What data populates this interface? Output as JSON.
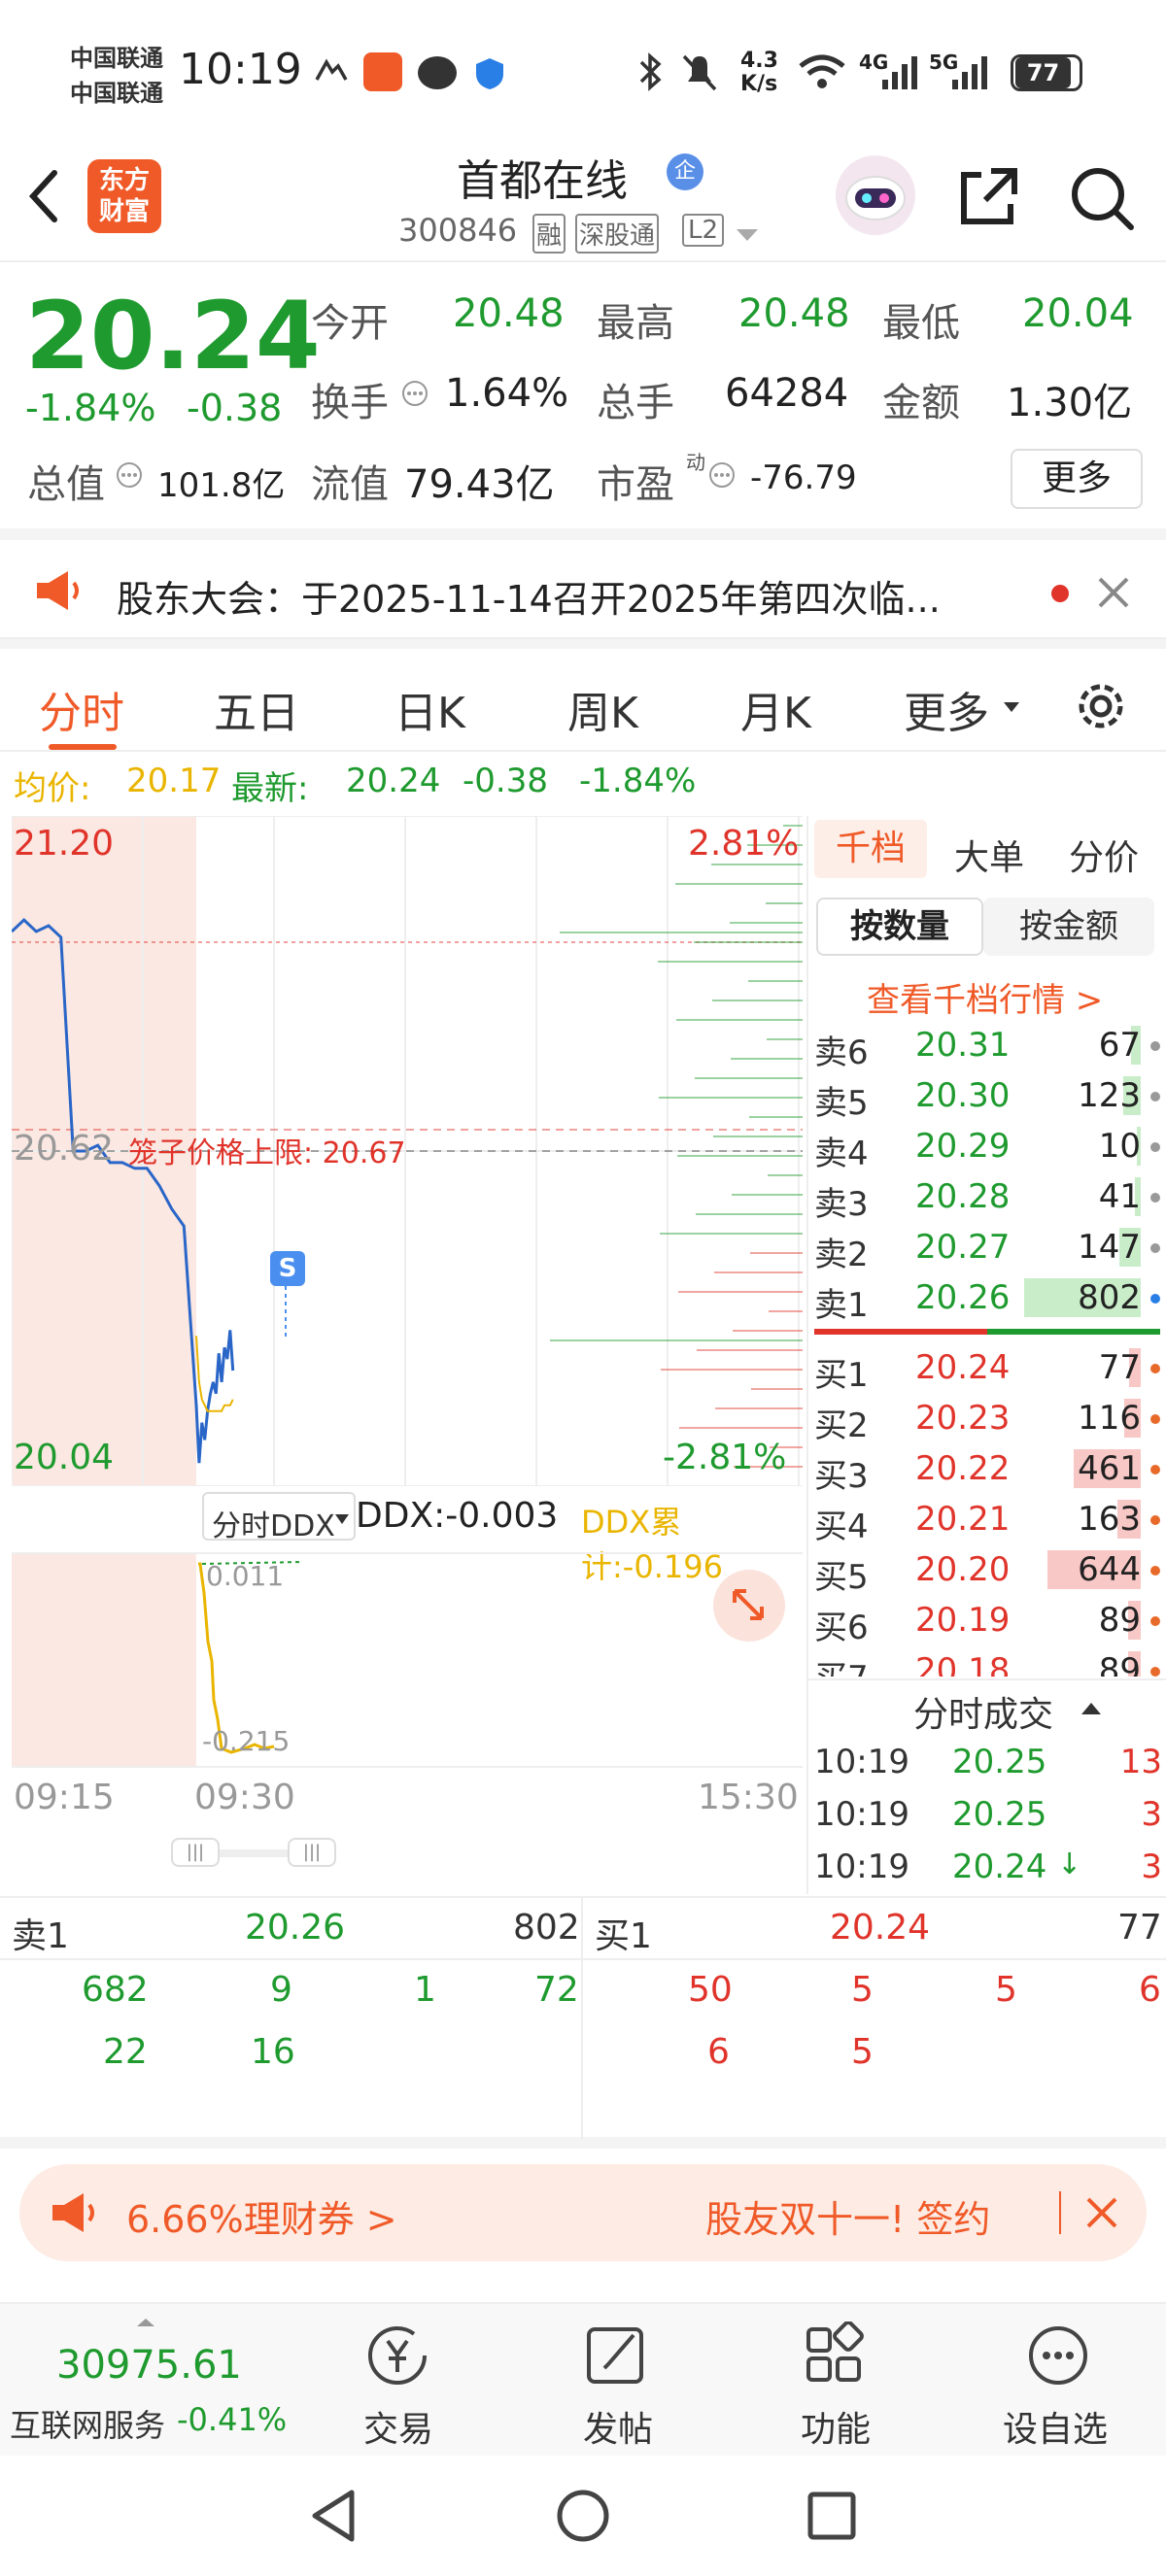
{
  "status_bar": {
    "carrier1": "中国联通",
    "carrier2": "中国联通",
    "time": "10:19",
    "net_speed_value": "4.3",
    "net_speed_unit": "K/s",
    "net1": "4G",
    "net2": "5G",
    "battery": "77"
  },
  "header": {
    "logo_line1": "东方",
    "logo_line2": "财富",
    "stock_name": "首都在线",
    "badge": "企",
    "stock_code": "300846",
    "tag_margin": "融",
    "tag_connect": "深股通",
    "tag_level": "L2"
  },
  "quote": {
    "price": "20.24",
    "change_pct": "-1.84%",
    "change": "-0.38",
    "open_label": "今开",
    "open": "20.48",
    "high_label": "最高",
    "high": "20.48",
    "low_label": "最低",
    "low": "20.04",
    "turnover_label": "换手",
    "turnover": "1.64%",
    "volume_label": "总手",
    "volume": "64284",
    "amount_label": "金额",
    "amount": "1.30亿",
    "mktcap_label": "总值",
    "mktcap": "101.8亿",
    "float_label": "流值",
    "float": "79.43亿",
    "pe_label": "市盈",
    "pe_sup": "动",
    "pe": "-76.79",
    "more_button": "更多"
  },
  "notice": {
    "text": "股东大会：于2025-11-14召开2025年第四次临..."
  },
  "tabs": {
    "items": [
      "分时",
      "五日",
      "日K",
      "周K",
      "月K",
      "更多"
    ],
    "active": "分时"
  },
  "chart_info": {
    "avg_label": "均价:",
    "avg_value": "20.17",
    "latest_label": "最新:",
    "latest_value": "20.24",
    "latest_change": "-0.38",
    "latest_pct": "-1.84%"
  },
  "chart_data": {
    "type": "line",
    "title": "",
    "y_top_label": "21.20",
    "y_mid_label": "20.62",
    "y_bottom_label": "20.04",
    "pct_top": "2.81%",
    "pct_bottom": "-2.81%",
    "limit_label": "笼子价格上限: 20.67",
    "x_labels": [
      "09:15",
      "09:30",
      "15:30"
    ],
    "ylim": [
      20.04,
      21.2
    ],
    "series": [
      {
        "name": "价格",
        "x": [
          "09:15",
          "09:16",
          "09:17",
          "09:18",
          "09:19",
          "09:20",
          "09:21",
          "09:22",
          "09:23",
          "09:24",
          "09:25",
          "09:26",
          "09:27",
          "09:28",
          "09:29",
          "09:30",
          "09:31",
          "09:32",
          "09:33",
          "09:34",
          "09:35",
          "09:36",
          "09:37",
          "09:38",
          "09:39",
          "09:40",
          "09:41",
          "09:42",
          "09:43"
        ],
        "values": [
          21.0,
          21.02,
          21.0,
          21.01,
          20.99,
          20.62,
          20.62,
          20.63,
          20.6,
          20.6,
          20.59,
          20.59,
          20.56,
          20.52,
          20.49,
          20.18,
          20.08,
          20.15,
          20.12,
          20.17,
          20.2,
          20.22,
          20.2,
          20.27,
          20.22,
          20.28,
          20.26,
          20.31,
          20.24
        ]
      },
      {
        "name": "均价",
        "x": [
          "09:30",
          "09:31",
          "09:32",
          "09:33",
          "09:34",
          "09:35",
          "09:36",
          "09:37",
          "09:38",
          "09:39",
          "09:40",
          "09:41",
          "09:42",
          "09:43"
        ],
        "values": [
          20.3,
          20.22,
          20.19,
          20.18,
          20.17,
          20.17,
          20.17,
          20.17,
          20.17,
          20.17,
          20.18,
          20.18,
          20.18,
          20.19
        ]
      }
    ]
  },
  "ddx": {
    "selector": "分时DDX",
    "value_label": "DDX:-0.003",
    "cum_label": "DDX累计:-0.196",
    "top_label": "0.011",
    "bottom_label": "-0.215"
  },
  "orderbook": {
    "tabs": [
      "千档",
      "大单",
      "分价"
    ],
    "active_tab": "千档",
    "subtabs": [
      "按数量",
      "按金额"
    ],
    "view_link": "查看千档行情 >",
    "asks": [
      {
        "label": "卖6",
        "price": "20.31",
        "qty": "67"
      },
      {
        "label": "卖5",
        "price": "20.30",
        "qty": "123"
      },
      {
        "label": "卖4",
        "price": "20.29",
        "qty": "10"
      },
      {
        "label": "卖3",
        "price": "20.28",
        "qty": "41"
      },
      {
        "label": "卖2",
        "price": "20.27",
        "qty": "147"
      },
      {
        "label": "卖1",
        "price": "20.26",
        "qty": "802"
      }
    ],
    "bids": [
      {
        "label": "买1",
        "price": "20.24",
        "qty": "77"
      },
      {
        "label": "买2",
        "price": "20.23",
        "qty": "116"
      },
      {
        "label": "买3",
        "price": "20.22",
        "qty": "461"
      },
      {
        "label": "买4",
        "price": "20.21",
        "qty": "163"
      },
      {
        "label": "买5",
        "price": "20.20",
        "qty": "644"
      },
      {
        "label": "买6",
        "price": "20.19",
        "qty": "89"
      },
      {
        "label": "买7",
        "price": "20.18",
        "qty": "89"
      }
    ],
    "trades_title": "分时成交",
    "trades": [
      {
        "time": "10:19",
        "price": "20.25",
        "qty": "13",
        "dir": ""
      },
      {
        "time": "10:19",
        "price": "20.25",
        "qty": "3",
        "dir": ""
      },
      {
        "time": "10:19",
        "price": "20.24",
        "qty": "3",
        "dir": "↓"
      }
    ]
  },
  "queue": {
    "sell_label": "卖1",
    "sell_price": "20.26",
    "sell_total": "802",
    "sell_orders": [
      "682",
      "9",
      "1",
      "72",
      "22",
      "16"
    ],
    "buy_label": "买1",
    "buy_price": "20.24",
    "buy_total": "77",
    "buy_orders": [
      "50",
      "5",
      "5",
      "6",
      "6",
      "5"
    ]
  },
  "ad_banner": {
    "left_text": "6.66%理财券 >",
    "right_text": "股友双十一! 签约"
  },
  "bottom_nav": {
    "index_value": "30975.61",
    "index_name": "互联网服务",
    "index_change": "-0.41%",
    "items": [
      "交易",
      "发帖",
      "功能",
      "设自选"
    ]
  }
}
